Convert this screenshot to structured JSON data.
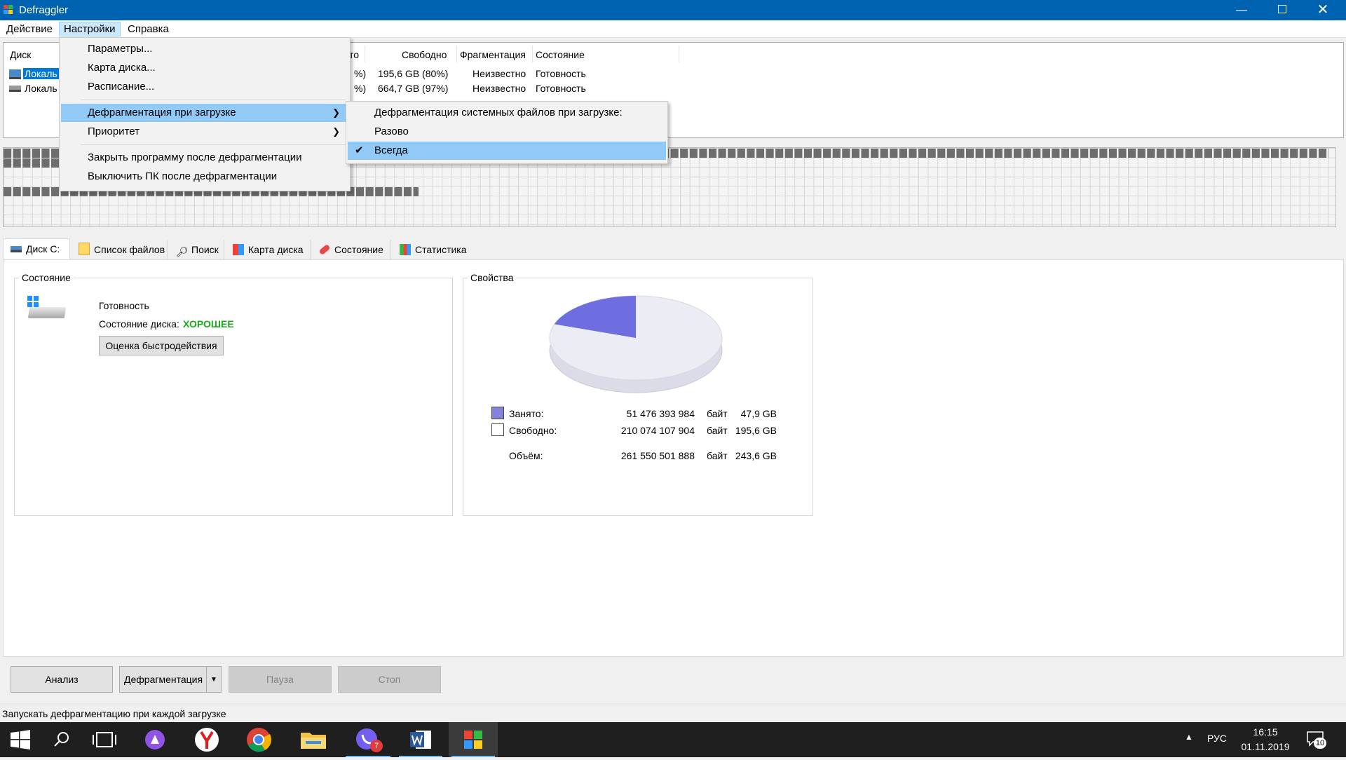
{
  "window": {
    "title": "Defraggler"
  },
  "menubar": {
    "items": [
      "Действие",
      "Настройки",
      "Справка"
    ]
  },
  "drive_list": {
    "headers": {
      "disk": "Диск",
      "used_partial": "то",
      "free": "Свободно",
      "frag": "Фрагментация",
      "state": "Состояние"
    },
    "rows": [
      {
        "name": "Локаль",
        "used_partial": "%)",
        "free": "195,6 GB (80%)",
        "frag": "Неизвестно",
        "state": "Готовность"
      },
      {
        "name": "Локаль",
        "used_partial": "%)",
        "free": "664,7 GB (97%)",
        "frag": "Неизвестно",
        "state": "Готовность"
      }
    ]
  },
  "settings_menu": {
    "items": [
      "Параметры...",
      "Карта диска...",
      "Расписание...",
      "Дефрагментация при загрузке",
      "Приоритет",
      "Закрыть программу после дефрагментации",
      "Выключить ПК после дефрагментации"
    ],
    "highlighted": "Дефрагментация при загрузке"
  },
  "boot_submenu": {
    "items": [
      "Дефрагментация системных файлов при загрузке:",
      "Разово",
      "Всегда"
    ],
    "checked": "Всегда"
  },
  "tabs": [
    "Диск C:",
    "Список файлов",
    "Поиск",
    "Карта диска",
    "Состояние",
    "Статистика"
  ],
  "status_group": {
    "legend": "Состояние",
    "ready": "Готовность",
    "disk_state_label": "Состояние диска:",
    "disk_state_value": "ХОРОШЕЕ",
    "bench_button": "Оценка быстродействия"
  },
  "properties_group": {
    "legend": "Свойства",
    "rows": [
      {
        "label": "Занято:",
        "bytes": "51 476 393 984",
        "unit": "байт",
        "size": "47,9 GB"
      },
      {
        "label": "Свободно:",
        "bytes": "210 074 107 904",
        "unit": "байт",
        "size": "195,6 GB"
      },
      {
        "label": "Объём:",
        "bytes": "261 550 501 888",
        "unit": "байт",
        "size": "243,6 GB"
      }
    ],
    "used_color": "#7777dd",
    "used_fraction": 0.197
  },
  "buttons": {
    "analyze": "Анализ",
    "defrag": "Дефрагментация",
    "pause": "Пауза",
    "stop": "Стоп"
  },
  "statusbar": {
    "text": "Запускать дефрагментацию при каждой загрузке"
  },
  "taskbar": {
    "lang": "РУС",
    "time": "16:15",
    "date": "01.11.2019",
    "viber_badge": "7",
    "notif_count": "10"
  }
}
